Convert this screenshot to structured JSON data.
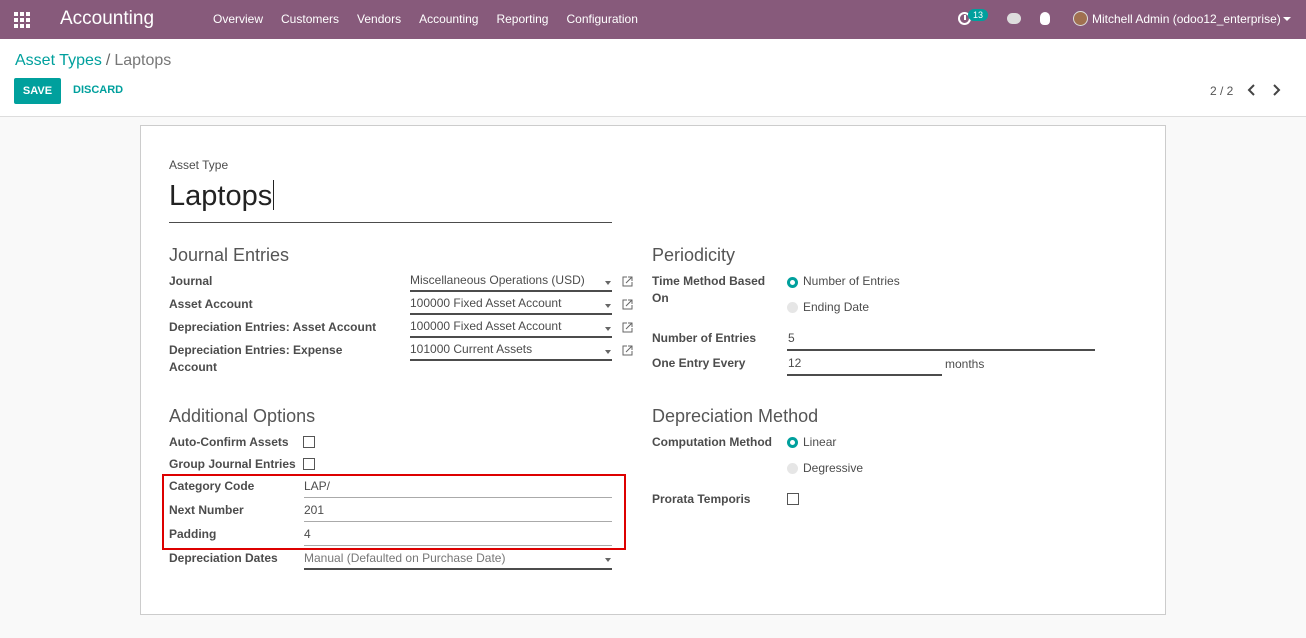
{
  "nav": {
    "brand": "Accounting",
    "menu": [
      "Overview",
      "Customers",
      "Vendors",
      "Accounting",
      "Reporting",
      "Configuration"
    ],
    "activity_count": "13",
    "user": "Mitchell Admin (odoo12_enterprise)"
  },
  "breadcrumb": {
    "parent": "Asset Types",
    "separator": "/",
    "current": "Laptops"
  },
  "buttons": {
    "save": "SAVE",
    "discard": "DISCARD"
  },
  "pager": "2 / 2",
  "form": {
    "name_label": "Asset Type",
    "name_value": "Laptops",
    "journal_entries": {
      "title": "Journal Entries",
      "journal_label": "Journal",
      "journal_value": "Miscellaneous Operations (USD)",
      "asset_account_label": "Asset Account",
      "asset_account_value": "100000 Fixed Asset Account",
      "dep_asset_label": "Depreciation Entries: Asset Account",
      "dep_asset_value": "100000 Fixed Asset Account",
      "dep_expense_label_1": "Depreciation Entries: Expense",
      "dep_expense_label_2": "Account",
      "dep_expense_value": "101000 Current Assets"
    },
    "periodicity": {
      "title": "Periodicity",
      "time_method_label_1": "Time Method Based",
      "time_method_label_2": "On",
      "option_entries": "Number of Entries",
      "option_ending": "Ending Date",
      "selected": "Number of Entries",
      "num_entries_label": "Number of Entries",
      "num_entries_value": "5",
      "entry_every_label": "One Entry Every",
      "entry_every_value": "12",
      "entry_every_unit": "months"
    },
    "additional": {
      "title": "Additional Options",
      "auto_confirm_label": "Auto-Confirm Assets",
      "auto_confirm_checked": false,
      "group_entries_label": "Group Journal Entries",
      "group_entries_checked": false,
      "category_code_label": "Category Code",
      "category_code_value": "LAP/",
      "next_number_label": "Next Number",
      "next_number_value": "201",
      "padding_label": "Padding",
      "padding_value": "4",
      "dep_dates_label": "Depreciation Dates",
      "dep_dates_value": "Manual (Defaulted on Purchase Date)"
    },
    "depreciation_method": {
      "title": "Depreciation Method",
      "computation_label": "Computation Method",
      "option_linear": "Linear",
      "option_degressive": "Degressive",
      "selected": "Linear",
      "prorata_label": "Prorata Temporis",
      "prorata_checked": false
    }
  },
  "colors": {
    "navbar": "#875a7b",
    "primary": "#00a09d",
    "highlight": "#dd0000"
  }
}
